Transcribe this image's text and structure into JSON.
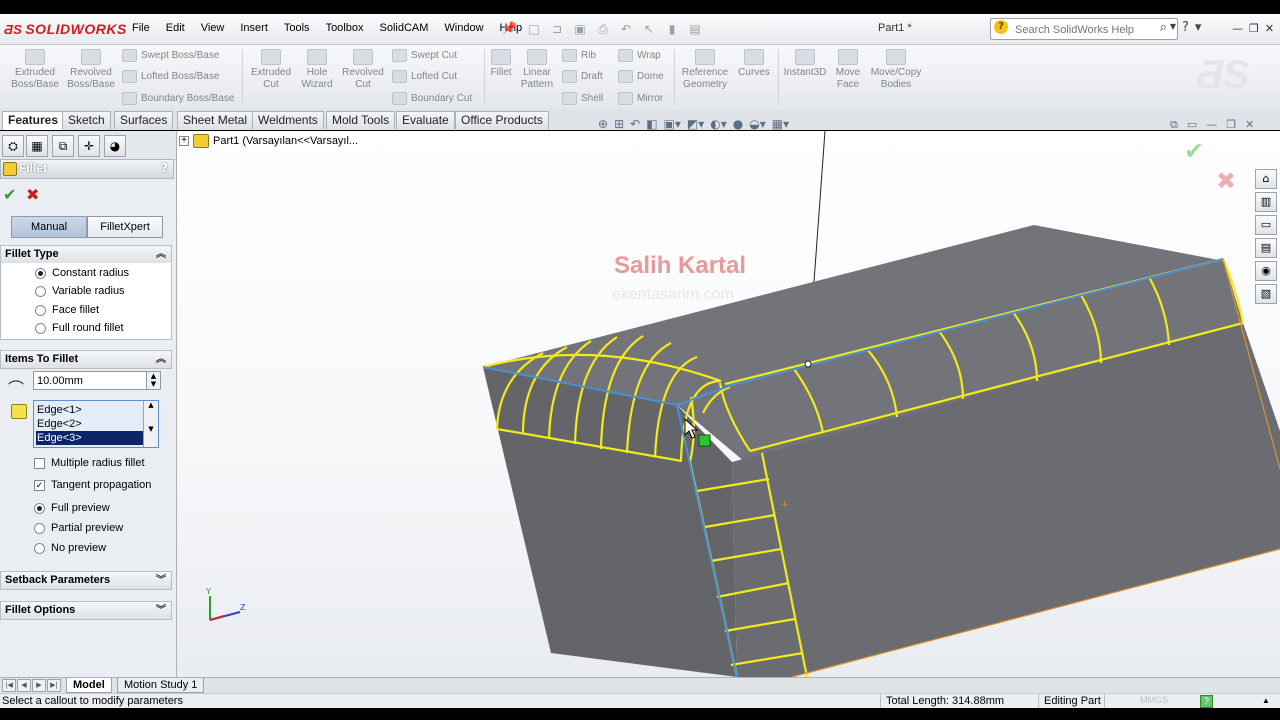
{
  "app": {
    "logo": "SOLIDWORKS",
    "document_title": "Part1 *"
  },
  "menu": [
    "File",
    "Edit",
    "View",
    "Insert",
    "Tools",
    "Toolbox",
    "SolidCAM",
    "Window",
    "Help"
  ],
  "search": {
    "placeholder": "Search SolidWorks Help"
  },
  "command_manager": {
    "extruded_boss": "Extruded Boss/Base",
    "revolved_boss": "Revolved Boss/Base",
    "swept_boss": "Swept Boss/Base",
    "lofted_boss": "Lofted Boss/Base",
    "boundary_boss": "Boundary Boss/Base",
    "extruded_cut": "Extruded Cut",
    "hole_wizard": "Hole Wizard",
    "revolved_cut": "Revolved Cut",
    "swept_cut": "Swept Cut",
    "lofted_cut": "Lofted Cut",
    "boundary_cut": "Boundary Cut",
    "fillet": "Fillet",
    "linear_pattern": "Linear Pattern",
    "rib": "Rib",
    "draft": "Draft",
    "shell": "Shell",
    "wrap": "Wrap",
    "dome": "Dome",
    "mirror": "Mirror",
    "reference_geometry": "Reference Geometry",
    "curves": "Curves",
    "instant3d": "Instant3D",
    "move_face": "Move Face",
    "move_copy_bodies": "Move/Copy Bodies"
  },
  "tabs": [
    "Features",
    "Sketch",
    "Surfaces",
    "Sheet Metal",
    "Weldments",
    "Mold Tools",
    "Evaluate",
    "Office Products"
  ],
  "property_manager": {
    "title": "Fillet",
    "help": "?",
    "mode_manual": "Manual",
    "mode_filletxpert": "FilletXpert",
    "fillet_type": {
      "title": "Fillet Type",
      "options": [
        "Constant radius",
        "Variable radius",
        "Face fillet",
        "Full round fillet"
      ],
      "selected": "Constant radius"
    },
    "items_to_fillet": {
      "title": "Items To Fillet",
      "radius": "10.00mm",
      "edges": [
        "Edge<1>",
        "Edge<2>",
        "Edge<3>"
      ],
      "selected_edge": "Edge<3>",
      "multiple_radius": "Multiple radius fillet",
      "tangent_propagation": "Tangent propagation",
      "preview_options": [
        "Full preview",
        "Partial preview",
        "No preview"
      ],
      "selected_preview": "Full preview"
    },
    "setback_parameters": "Setback Parameters",
    "fillet_options": "Fillet Options"
  },
  "graphics": {
    "tree_root": "Part1  (Varsayılan<<Varsayıl...",
    "watermark_name": "Salih Kartal",
    "watermark_site": "ekentasarim.com",
    "triad_y": "Y",
    "triad_z": "Z"
  },
  "bottom_tabs": [
    "Model",
    "Motion Study 1"
  ],
  "status": {
    "message": "Select a callout to modify parameters",
    "total_length": "Total Length: 314.88mm",
    "mode": "Editing Part",
    "units": "MMGS"
  },
  "colors": {
    "body_gray": "#6f7177",
    "fillet_yellow": "#f3ea1b",
    "edge_blue": "#4a8fd8",
    "orange_edge": "#e0932a",
    "logo_red": "#d7191f"
  }
}
